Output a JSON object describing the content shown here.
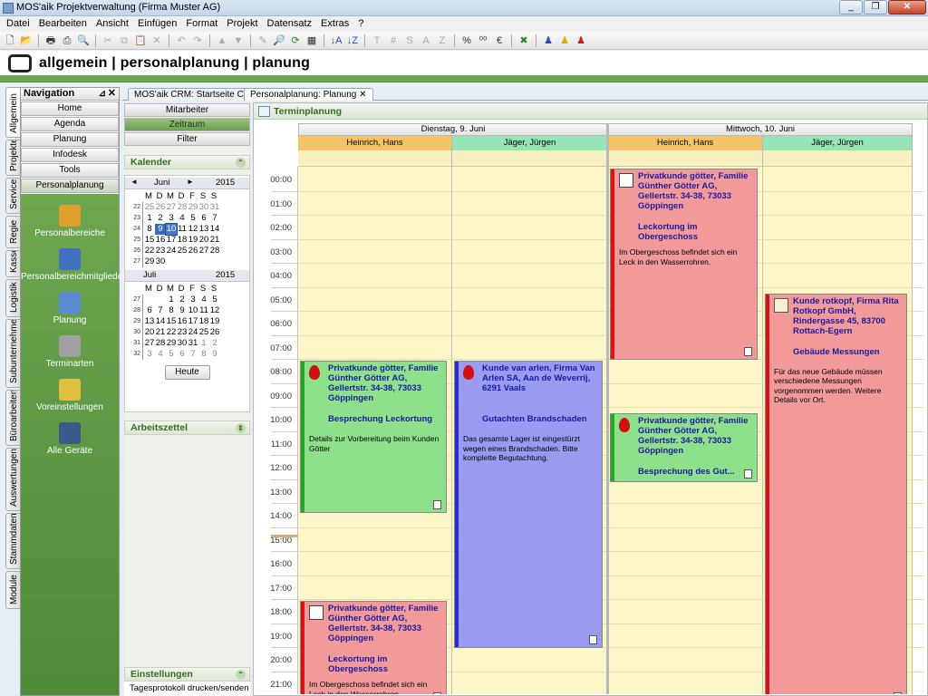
{
  "window": {
    "title": "MOS'aik Projektverwaltung (Firma Muster AG)",
    "buttons": [
      "_",
      "❐",
      "✕"
    ]
  },
  "menu": [
    "Datei",
    "Bearbeiten",
    "Ansicht",
    "Einfügen",
    "Format",
    "Projekt",
    "Datensatz",
    "Extras",
    "?"
  ],
  "toolbar_glyphs": {
    "bold": "T",
    "italic": "#",
    "s1": "S",
    "s2": "A",
    "z": "Z",
    "percent": "%",
    "euro": "€"
  },
  "breadcrumb": "allgemein | personalplanung | planung",
  "vertical_tabs": [
    "Allgemein",
    "Projekte",
    "Service",
    "Regie",
    "Kasse",
    "Logistik",
    "Subunternehmer",
    "Büroarbeiten",
    "Auswertungen",
    "Stammdaten",
    "Module"
  ],
  "nav": {
    "title": "Navigation",
    "pin": "⊿",
    "close": "✕",
    "buttons": [
      "Home",
      "Agenda",
      "Planung",
      "Infodesk",
      "Tools",
      "Personalplanung"
    ],
    "items": [
      "Personalbereiche",
      "Personalbereichmitglieder",
      "Planung",
      "Terminarten",
      "Voreinstellungen",
      "Alle Geräte"
    ]
  },
  "doc_tabs": [
    "MOS'aik CRM: Startseite CRM",
    "Personalplanung: Planung"
  ],
  "doc_tab_close": "✕",
  "left_panel": {
    "buttons": [
      "Mitarbeiter",
      "Zeitraum",
      "Filter"
    ],
    "kalender_title": "Kalender",
    "arbeitszettel_title": "Arbeitszettel",
    "einstellungen_title": "Einstellungen",
    "einstellungen_item": "Tagesprotokoll drucken/senden",
    "today_button": "Heute",
    "month1": {
      "name": "Juni",
      "year": "2015",
      "nav_prev": "◄",
      "nav_next": "►",
      "weekdays": [
        "M",
        "D",
        "M",
        "D",
        "F",
        "S",
        "S"
      ],
      "weeks": [
        {
          "wk": "22",
          "days": [
            "25",
            "26",
            "27",
            "28",
            "29",
            "30",
            "31"
          ],
          "grey": [
            0,
            1,
            2,
            3,
            4,
            5,
            6
          ]
        },
        {
          "wk": "23",
          "days": [
            "1",
            "2",
            "3",
            "4",
            "5",
            "6",
            "7"
          ],
          "grey": []
        },
        {
          "wk": "24",
          "days": [
            "8",
            "9",
            "10",
            "11",
            "12",
            "13",
            "14"
          ],
          "grey": []
        },
        {
          "wk": "25",
          "days": [
            "15",
            "16",
            "17",
            "18",
            "19",
            "20",
            "21"
          ],
          "grey": []
        },
        {
          "wk": "26",
          "days": [
            "22",
            "23",
            "24",
            "25",
            "26",
            "27",
            "28"
          ],
          "grey": []
        },
        {
          "wk": "27",
          "days": [
            "29",
            "30",
            "",
            "",
            "",
            "",
            ""
          ],
          "grey": []
        }
      ]
    },
    "month2": {
      "name": "Juli",
      "year": "2015",
      "weekdays": [
        "M",
        "D",
        "M",
        "D",
        "F",
        "S",
        "S"
      ],
      "weeks": [
        {
          "wk": "27",
          "days": [
            "",
            "",
            "1",
            "2",
            "3",
            "4",
            "5"
          ],
          "grey": []
        },
        {
          "wk": "28",
          "days": [
            "6",
            "7",
            "8",
            "9",
            "10",
            "11",
            "12"
          ],
          "grey": []
        },
        {
          "wk": "29",
          "days": [
            "13",
            "14",
            "15",
            "16",
            "17",
            "18",
            "19"
          ],
          "grey": []
        },
        {
          "wk": "30",
          "days": [
            "20",
            "21",
            "22",
            "23",
            "24",
            "25",
            "26"
          ],
          "grey": []
        },
        {
          "wk": "31",
          "days": [
            "27",
            "28",
            "29",
            "30",
            "31",
            "1",
            "2"
          ],
          "grey": [
            5,
            6
          ]
        },
        {
          "wk": "32",
          "days": [
            "3",
            "4",
            "5",
            "6",
            "7",
            "8",
            "9"
          ],
          "grey": [
            0,
            1,
            2,
            3,
            4,
            5,
            6
          ]
        }
      ]
    }
  },
  "main": {
    "title": "Terminplanung",
    "days": [
      "Dienstag, 9. Juni",
      "Mittwoch, 10. Juni"
    ],
    "resources": [
      "Heinrich, Hans",
      "Jäger, Jürgen",
      "Heinrich, Hans",
      "Jäger, Jürgen"
    ],
    "times": [
      "00:00",
      "01:00",
      "02:00",
      "03:00",
      "04:00",
      "05:00",
      "06:00",
      "07:00",
      "08:00",
      "09:00",
      "10:00",
      "11:00",
      "12:00",
      "13:00",
      "14:00",
      "15:00",
      "16:00",
      "17:00",
      "18:00",
      "19:00",
      "20:00",
      "21:00"
    ],
    "appointments": [
      {
        "title": "Privatkunde götter, Familie Günther Götter AG, Gellertstr. 34-38, 73033 Göppingen",
        "subject": "Besprechung Leckortung",
        "body": "Details zur Vorbereitung beim Kunden Götter",
        "color": "#8ee08a",
        "bar": "#22a822",
        "icon": "drop"
      },
      {
        "title": "Kunde van arlen, Firma Van Arlen SA, Aan de Weverrij, 6291 Vaals",
        "subject": "Gutachten Brandschaden",
        "body": "Das gesamte Lager ist eingestürzt wegen eines Brandschaden. Bitte komplette Begutachtung.",
        "color": "#9a9af0",
        "bar": "#2a2ad0",
        "icon": "drop"
      },
      {
        "title": "Privatkunde götter, Familie Günther Götter AG, Gellertstr. 34-38, 73033 Göppingen",
        "subject": "Leckortung im Obergeschoss",
        "body": "Im Obergeschoss befindet sich ein Leck in den Wasserrohren.",
        "color": "#f29a9a",
        "bar": "#e01010",
        "icon": "tap"
      },
      {
        "title": "Privatkunde götter, Familie Günther Götter AG, Gellertstr. 34-38, 73033 Göppingen",
        "subject": "Besprechung des Gut...",
        "body": "",
        "color": "#8ee08a",
        "bar": "#22a822",
        "icon": "drop"
      },
      {
        "title": "Kunde rotkopf, Firma Rita Rotkopf GmbH, Rindergasse 45, 83700 Rottach-Egern",
        "subject": "Gebäude Messungen",
        "body": "Für das neue Gebäude müssen verschiedene Messungen vorgenommen werden. Weitere Details vor Ort.",
        "color": "#f29a9a",
        "bar": "#e01010",
        "icon": "meter"
      },
      {
        "title": "Privatkunde götter, Familie Günther Götter AG, Gellertstr. 34-38, 73033 Göppingen",
        "subject": "Leckortung im Obergeschoss",
        "body": "Im Obergeschoss befindet sich ein Leck in den Wasserrohren.",
        "color": "#f29a9a",
        "bar": "#e01010",
        "icon": "tap"
      }
    ]
  }
}
